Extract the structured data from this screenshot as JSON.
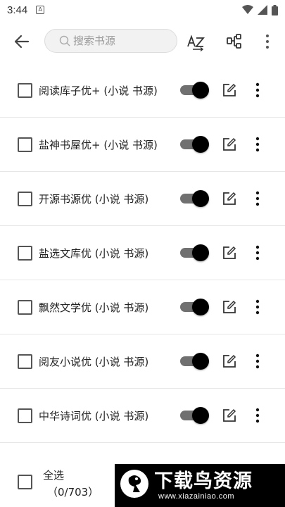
{
  "status_bar": {
    "time": "3:44",
    "notification_icon": "A"
  },
  "toolbar": {
    "back_icon": "arrow-left",
    "search_placeholder": "搜索书源",
    "sort_icon": "az-sort",
    "group_icon": "group-tree",
    "more_icon": "more-vertical"
  },
  "sources": [
    {
      "label": "阅读库子优+ (小说 书源)",
      "checked": false,
      "enabled": true
    },
    {
      "label": "盐神书屋优+ (小说 书源)",
      "checked": false,
      "enabled": true
    },
    {
      "label": "开源书源优 (小说 书源)",
      "checked": false,
      "enabled": true
    },
    {
      "label": "盐选文库优 (小说 书源)",
      "checked": false,
      "enabled": true
    },
    {
      "label": "飘然文学优 (小说 书源)",
      "checked": false,
      "enabled": true
    },
    {
      "label": "阅友小说优 (小说 书源)",
      "checked": false,
      "enabled": true
    },
    {
      "label": "中华诗词优 (小说 书源)",
      "checked": false,
      "enabled": true
    }
  ],
  "bottom_bar": {
    "select_all_label": "全选",
    "select_count": "（0/703）"
  },
  "watermark": {
    "title": "下载鸟资源",
    "url": "www.xiazainiao.com"
  },
  "colors": {
    "switch_thumb": "#000000",
    "switch_track": "#707070",
    "divider": "#e6e6e6"
  }
}
